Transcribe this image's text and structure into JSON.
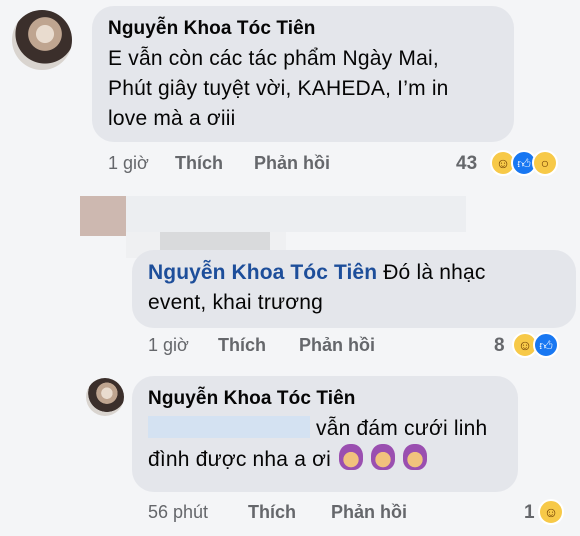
{
  "comments": [
    {
      "author": "Nguyễn Khoa Tóc Tiên",
      "lines": [
        "E vẫn còn các tác phẩm Ngày Mai,",
        "Phút giây tuyệt vời, KAHEDA, I’m in",
        "love mà a ơiii"
      ],
      "time": "1 giờ",
      "like_label": "Thích",
      "reply_label": "Phản hồi",
      "reaction_count": "43",
      "reactions": [
        "haha-icon",
        "like-icon",
        "wow-icon"
      ]
    },
    {
      "author": "Nguyễn Khoa Tóc Tiên",
      "text_after_name": "Đó là nhạc",
      "line2": "event, khai trương",
      "time": "1 giờ",
      "like_label": "Thích",
      "reply_label": "Phản hồi",
      "reaction_count": "8",
      "reactions": [
        "haha-icon",
        "like-icon"
      ]
    },
    {
      "author": "Nguyễn Khoa Tóc Tiên",
      "line1_text": "vẫn đám cưới linh",
      "line2_text": "đình được nha a ơi",
      "time": "56 phút",
      "like_label": "Thích",
      "reply_label": "Phản hồi",
      "reaction_count": "1",
      "reactions": [
        "haha-icon"
      ]
    }
  ],
  "colors": {
    "bubble": "#e4e6eb",
    "tag_blue": "#1d4e9a",
    "meta_gray": "#65676b",
    "like_blue": "#1877f2"
  }
}
